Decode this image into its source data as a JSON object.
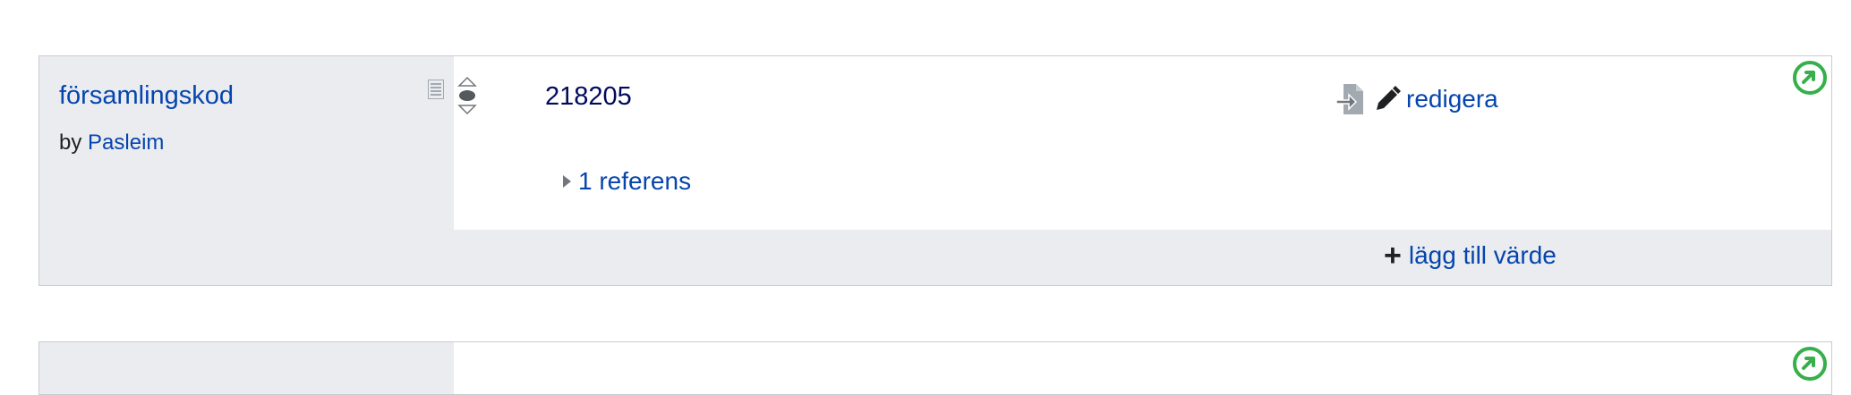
{
  "statement": {
    "property_label": "församlingskod",
    "by_prefix": "by",
    "by_user": "Pasleim",
    "value": "218205",
    "edit_label": "redigera",
    "references_label": "1 referens",
    "add_value_label": "lägg till värde"
  },
  "colors": {
    "link": "#0645ad",
    "value_text": "#000b5c",
    "border": "#c8ccd1",
    "gray_bg": "#eaecf0",
    "jump_green": "#36b04a"
  },
  "icons": {
    "rank": "rank-normal-icon",
    "doc": "document-list-icon",
    "import": "import-file-icon",
    "edit": "pencil-icon",
    "jump": "arrow-circle-icon",
    "expand": "triangle-right-icon",
    "add": "plus-icon"
  }
}
